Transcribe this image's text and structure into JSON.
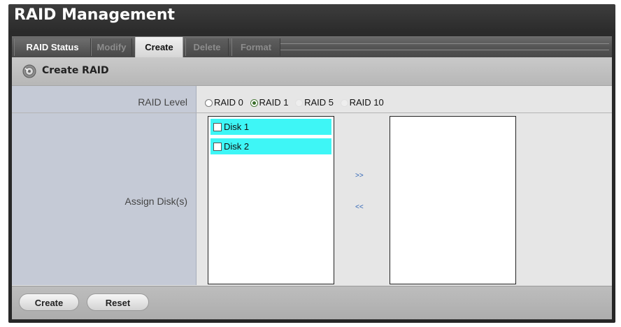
{
  "app": {
    "title": "RAID Management"
  },
  "tabs": [
    {
      "label": "RAID Status",
      "state": "normal"
    },
    {
      "label": "Modify",
      "state": "disabled"
    },
    {
      "label": "Create",
      "state": "selected"
    },
    {
      "label": "Delete",
      "state": "disabled"
    },
    {
      "label": "Format",
      "state": "disabled"
    }
  ],
  "panel": {
    "title": "Create RAID",
    "icon": "disk-gear-icon"
  },
  "form": {
    "raid_level_label": "RAID Level",
    "raid_levels": [
      {
        "label": "RAID 0",
        "checked": false,
        "enabled": true
      },
      {
        "label": "RAID 1",
        "checked": true,
        "enabled": true
      },
      {
        "label": "RAID 5",
        "checked": false,
        "enabled": false
      },
      {
        "label": "RAID 10",
        "checked": false,
        "enabled": false
      }
    ],
    "assign_label": "Assign Disk(s)",
    "available_disks": [
      {
        "label": "Disk 1",
        "checked": false
      },
      {
        "label": "Disk 2",
        "checked": false
      }
    ],
    "assigned_disks": [],
    "move_right_label": ">>",
    "move_left_label": "<<"
  },
  "footer": {
    "create_label": "Create",
    "reset_label": "Reset"
  },
  "colors": {
    "disk_highlight": "#3ef6f6",
    "label_cell_bg": "#c5cad6",
    "link_blue": "#2d63b5"
  }
}
